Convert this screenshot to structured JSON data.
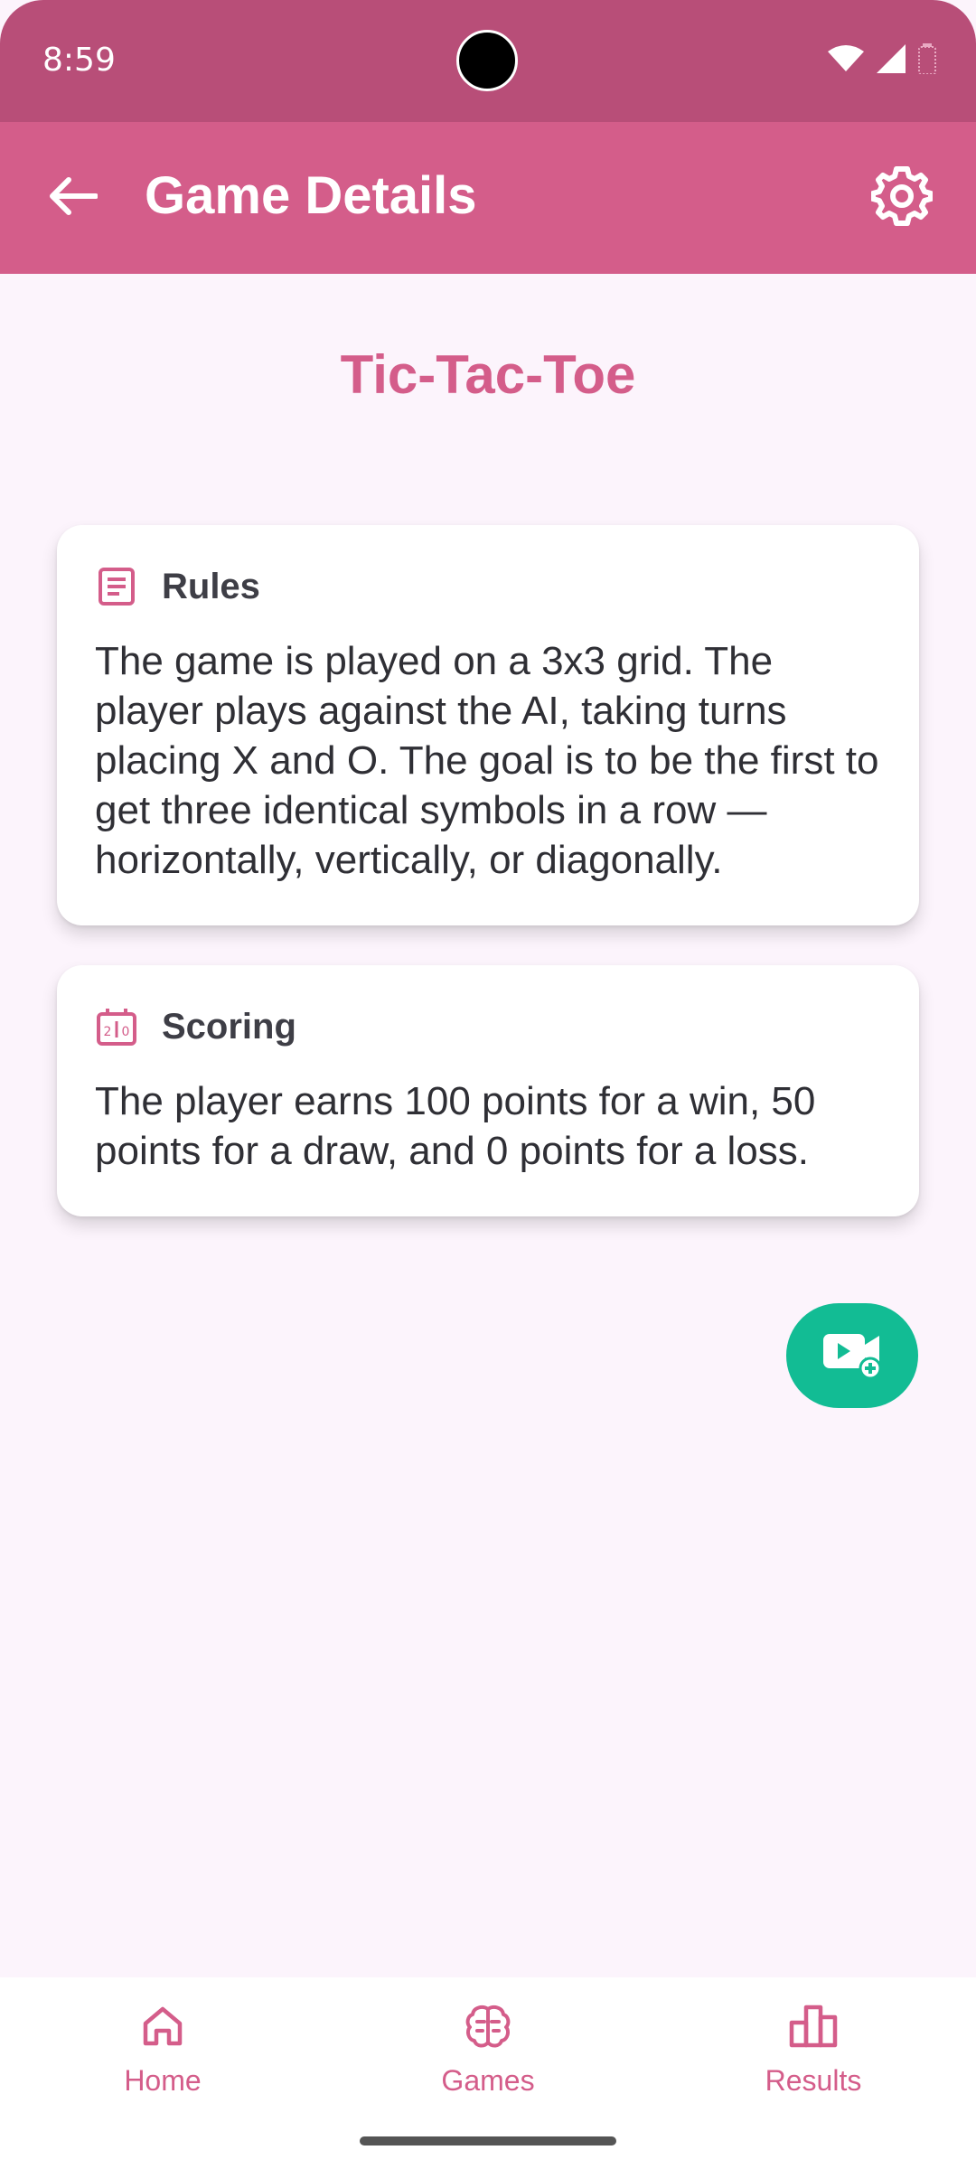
{
  "status_bar": {
    "time": "8:59",
    "icons": [
      "wifi-icon",
      "signal-icon",
      "battery-icon"
    ]
  },
  "app_bar": {
    "title": "Game Details",
    "back_icon": "arrow-left-icon",
    "settings_icon": "gear-icon"
  },
  "game": {
    "title": "Tic-Tac-Toe"
  },
  "cards": {
    "rules": {
      "icon": "document-list-icon",
      "title": "Rules",
      "body": "The game is played on a 3x3 grid. The player plays against the AI, taking turns placing X and O. The goal is to be the first to get three identical symbols in a row — horizontally, vertically, or diagonally."
    },
    "scoring": {
      "icon": "scoreboard-icon",
      "title": "Scoring",
      "body": "The player earns 100 points for a win, 50 points for a draw, and 0 points for a loss."
    }
  },
  "fab": {
    "icon": "video-add-icon"
  },
  "bottom_nav": {
    "items": [
      {
        "label": "Home",
        "icon": "home-icon"
      },
      {
        "label": "Games",
        "icon": "brain-icon"
      },
      {
        "label": "Results",
        "icon": "bar-chart-icon"
      }
    ]
  },
  "colors": {
    "status_bar": "#B84E78",
    "app_bar": "#D45D8A",
    "accent": "#D45D8A",
    "fab": "#12BC94",
    "background": "#FCF4FC"
  }
}
